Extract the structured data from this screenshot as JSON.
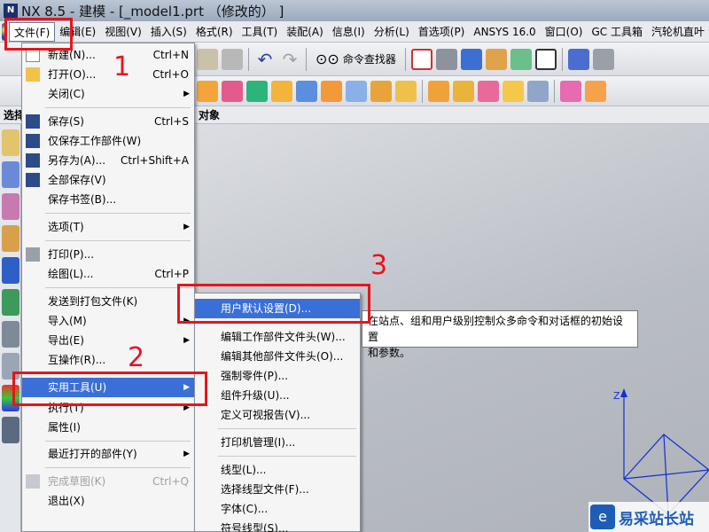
{
  "window": {
    "title": "NX 8.5 - 建模 - [_model1.prt （修改的） ]",
    "logo_text": "N"
  },
  "menubar": {
    "items": [
      "文件(F)",
      "编辑(E)",
      "视图(V)",
      "插入(S)",
      "格式(R)",
      "工具(T)",
      "装配(A)",
      "信息(I)",
      "分析(L)",
      "首选项(P)",
      "ANSYS 16.0",
      "窗口(O)",
      "GC 工具箱",
      "汽轮机直叶"
    ]
  },
  "toolbar": {
    "command_finder": "命令查找器",
    "selection_prefix": "选择",
    "selection_suffix": "对象"
  },
  "file_menu": {
    "new": {
      "label": "新建(N)...",
      "shortcut": "Ctrl+N"
    },
    "open": {
      "label": "打开(O)...",
      "shortcut": "Ctrl+O"
    },
    "close": {
      "label": "关闭(C)"
    },
    "save": {
      "label": "保存(S)",
      "shortcut": "Ctrl+S"
    },
    "save_work_part": {
      "label": "仅保存工作部件(W)"
    },
    "save_as": {
      "label": "另存为(A)...",
      "shortcut": "Ctrl+Shift+A"
    },
    "save_all": {
      "label": "全部保存(V)"
    },
    "save_bookmark": {
      "label": "保存书签(B)..."
    },
    "options": {
      "label": "选项(T)"
    },
    "print": {
      "label": "打印(P)..."
    },
    "plot": {
      "label": "绘图(L)...",
      "shortcut": "Ctrl+P"
    },
    "send_to_package": {
      "label": "发送到打包文件(K)"
    },
    "import": {
      "label": "导入(M)"
    },
    "export": {
      "label": "导出(E)"
    },
    "interop": {
      "label": "互操作(R)..."
    },
    "utilities": {
      "label": "实用工具(U)"
    },
    "execute": {
      "label": "执行(T)"
    },
    "properties": {
      "label": "属性(I)"
    },
    "recent_parts": {
      "label": "最近打开的部件(Y)"
    },
    "finish_sketch": {
      "label": "完成草图(K)",
      "shortcut": "Ctrl+Q"
    },
    "exit": {
      "label": "退出(X)"
    }
  },
  "utilities_menu": {
    "items": [
      "用户默认设置(D)...",
      "编辑工作部件文件头(W)...",
      "编辑其他部件文件头(O)...",
      "强制零件(P)...",
      "组件升级(U)...",
      "定义可视报告(V)...",
      "打印机管理(I)...",
      "线型(L)...",
      "选择线型文件(F)...",
      "字体(C)...",
      "符号线型(S)..."
    ]
  },
  "tooltip": {
    "line1": "在站点、组和用户级别控制众多命令和对话框的初始设置",
    "line2": "和参数。"
  },
  "annotations": {
    "n1": "1",
    "n2": "2",
    "n3": "3"
  },
  "viewport": {
    "axis_label": "Z"
  },
  "watermark": {
    "logo_text": "e",
    "text": "易采站长站"
  },
  "colors": {
    "highlight": "#3a6fd8",
    "annotation_red": "#e8141c"
  }
}
